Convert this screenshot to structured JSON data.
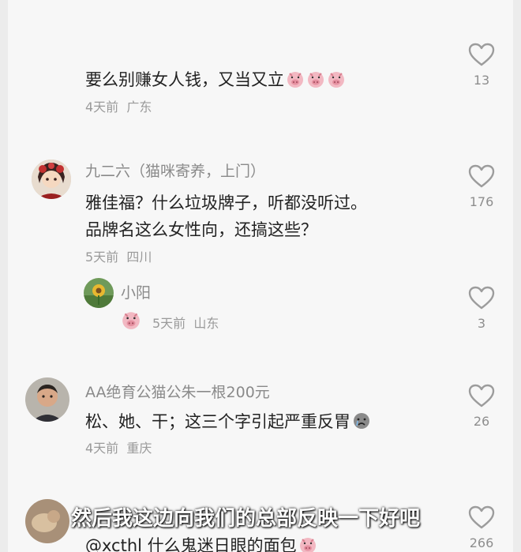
{
  "comments": [
    {
      "text": "要么别赚女人钱，又当又立",
      "emoji_count": 3,
      "time": "4天前",
      "location": "广东",
      "likes": "13"
    },
    {
      "name": "九二六（猫咪寄养，上门）",
      "text_line1": "雅佳福？什么垃圾牌子，听都没听过。",
      "text_line2": "品牌名这么女性向，还搞这些？",
      "time": "5天前",
      "location": "四川",
      "likes": "176"
    },
    {
      "name": "小阳",
      "time": "5天前",
      "location": "山东",
      "likes": "3"
    },
    {
      "name": "AA绝育公猫公朱一根200元",
      "text": "松、她、干；这三个字引起严重反胃",
      "time": "4天前",
      "location": "重庆",
      "likes": "26"
    },
    {
      "text": "@xcthl 什么鬼迷日眼的面包",
      "likes": "266"
    }
  ],
  "subtitle": "然后我这边向我们的总部反映一下好吧",
  "icons": {
    "like": "heart-outline-icon",
    "emoji": "pig-face-emoji-icon",
    "cry": "crying-face-emoji-icon"
  }
}
